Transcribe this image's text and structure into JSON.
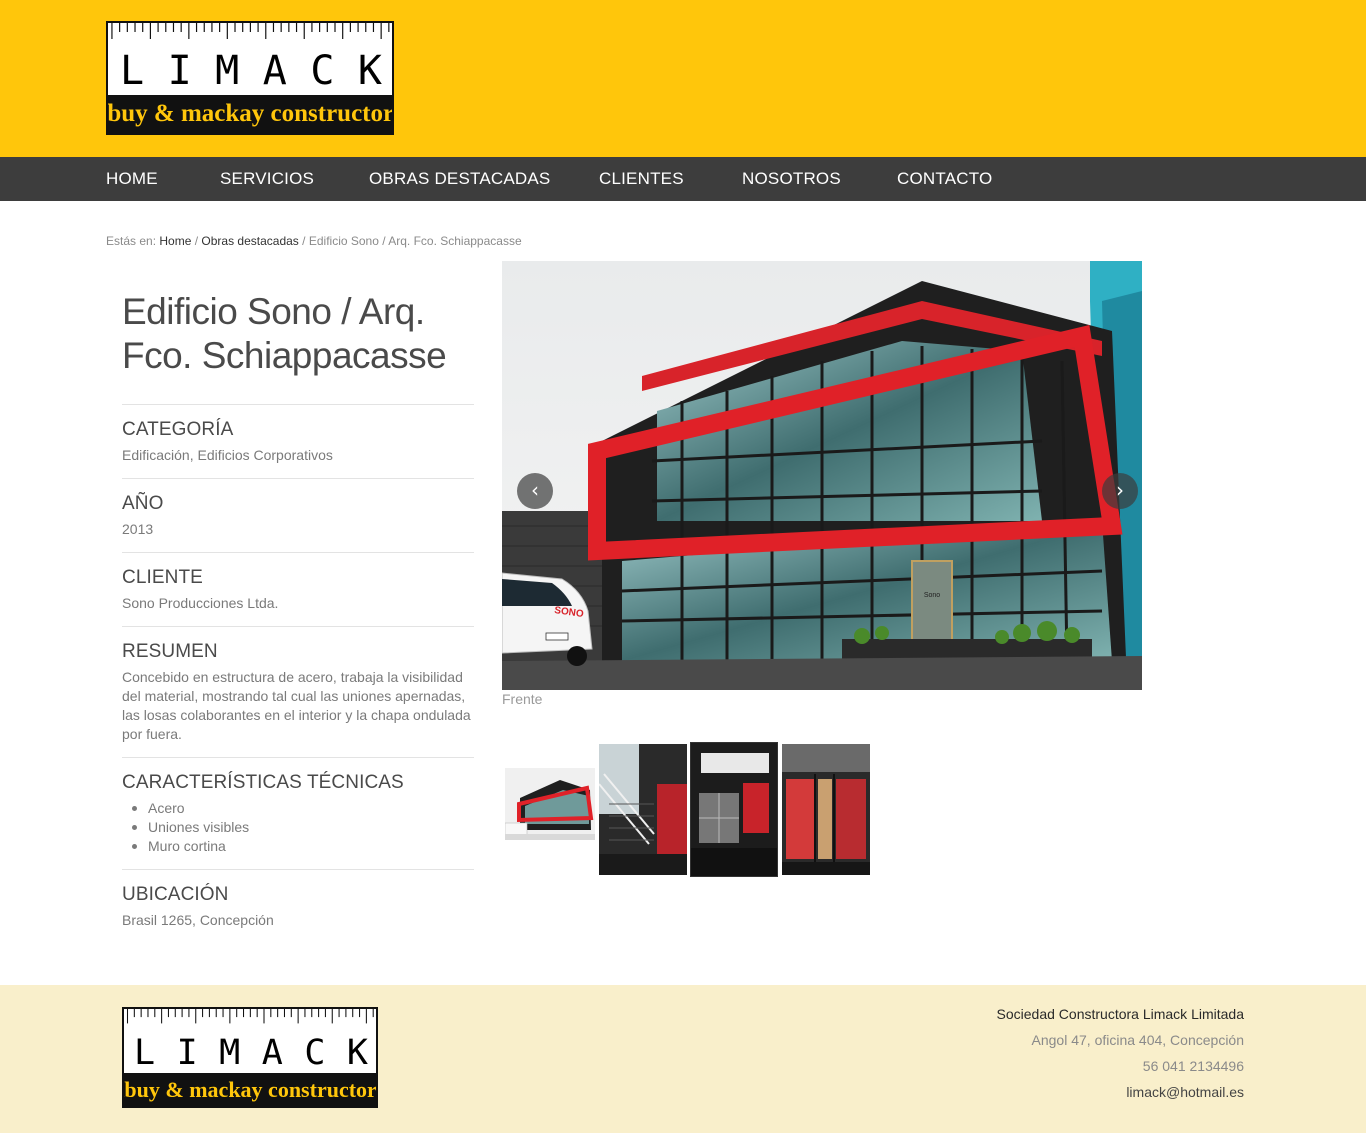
{
  "brand": {
    "letters": [
      "L",
      "I",
      "M",
      "A",
      "C",
      "K"
    ],
    "tagline": "libuy & mackay constructora",
    "header_color": "#ffc60b",
    "nav_color": "#3d3d3d",
    "footer_color": "#f9efcb"
  },
  "nav": {
    "items": [
      "HOME",
      "SERVICIOS",
      "OBRAS DESTACADAS",
      "CLIENTES",
      "NOSOTROS",
      "CONTACTO"
    ]
  },
  "breadcrumb": {
    "prefix": "Estás en:",
    "home": "Home",
    "section": "Obras destacadas",
    "current": "Edificio Sono / Arq. Fco. Schiappacasse",
    "separator": "/"
  },
  "project": {
    "title": "Edificio Sono / Arq. Fco. Schiappacasse",
    "category_label": "CATEGORÍA",
    "category": "Edificación, Edificios Corporativos",
    "year_label": "AÑO",
    "year": "2013",
    "client_label": "CLIENTE",
    "client": "Sono Producciones Ltda.",
    "summary_label": "RESUMEN",
    "summary": "Concebido en estructura de acero, trabaja la visibilidad del material, mostrando tal cual las uniones apernadas, las losas colaborantes en el interior y la chapa ondulada por fuera.",
    "features_label": "CARACTERÍSTICAS TÉCNICAS",
    "features": [
      "Acero",
      "Uniones visibles",
      "Muro cortina"
    ],
    "location_label": "UBICACIÓN",
    "location": "Brasil 1265, Concepción"
  },
  "slider": {
    "caption": "Frente",
    "prev_icon": "chevron-left-icon",
    "next_icon": "chevron-right-icon",
    "van_text": "SONO",
    "door_text": "Sono"
  },
  "footer": {
    "company": "Sociedad Constructora Limack Limitada",
    "address": "Angol 47, oficina 404, Concepción",
    "phone": "56 041 2134496",
    "email": "limack@hotmail.es"
  }
}
